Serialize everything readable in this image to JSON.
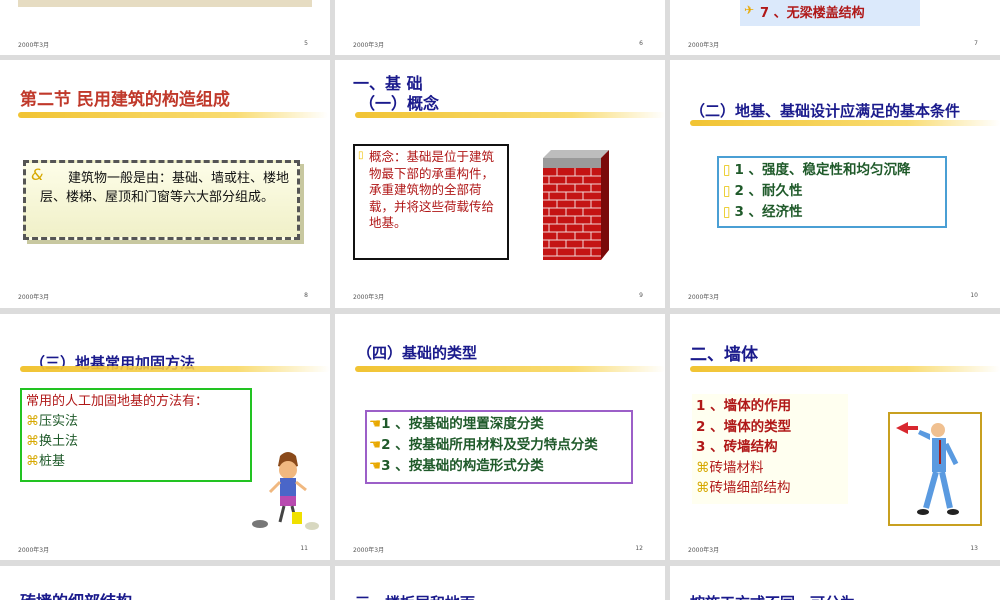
{
  "colors": {
    "red": "#c0392b",
    "navy": "#1a1a8c",
    "highlight": "#f2c43a"
  },
  "footer_date": "2000年3月",
  "row0": [
    {
      "num": "5"
    },
    {
      "num": "6"
    },
    {
      "num": "7",
      "item": "7 、无梁楼盖结构"
    }
  ],
  "s8": {
    "num": "8",
    "title": "第二节  民用建筑的构造组成",
    "body": "建筑物一般是由：基础、墙或柱、楼地层、楼梯、屋顶和门窗等六大部分组成。"
  },
  "s9": {
    "num": "9",
    "title1": "一、基    础",
    "title2": "（一）概念",
    "body": "概念：基础是位于建筑物最下部的承重构件，承重建筑物的全部荷载，并将这些荷载传给地基。"
  },
  "s10": {
    "num": "10",
    "title": "（二）地基、基础设计应满足的基本条件",
    "items": [
      "1 、强度、稳定性和均匀沉降",
      "2 、耐久性",
      "3 、经济性"
    ]
  },
  "s11": {
    "num": "11",
    "title": "（三）地基常用加固方法",
    "lead": "常用的人工加固地基的方法有：",
    "items": [
      "压实法",
      "换土法",
      "桩基"
    ]
  },
  "s12": {
    "num": "12",
    "title": "（四）基础的类型",
    "items": [
      "1 、按基础的埋置深度分类",
      "2 、按基础所用材料及受力特点分类",
      "3 、按基础的构造形式分类"
    ]
  },
  "s13": {
    "num": "13",
    "title": "二、墙体",
    "items": [
      "1 、墙体的作用",
      "2 、墙体的类型",
      "3 、砖墙结构"
    ],
    "subitems": [
      "砖墙材料",
      "砖墙细部结构"
    ]
  },
  "row3": [
    {
      "title": "砖墙的细部结构"
    },
    {
      "title": "三、楼板层和地面"
    },
    {
      "title": "按施工方式不同，可分为"
    }
  ]
}
